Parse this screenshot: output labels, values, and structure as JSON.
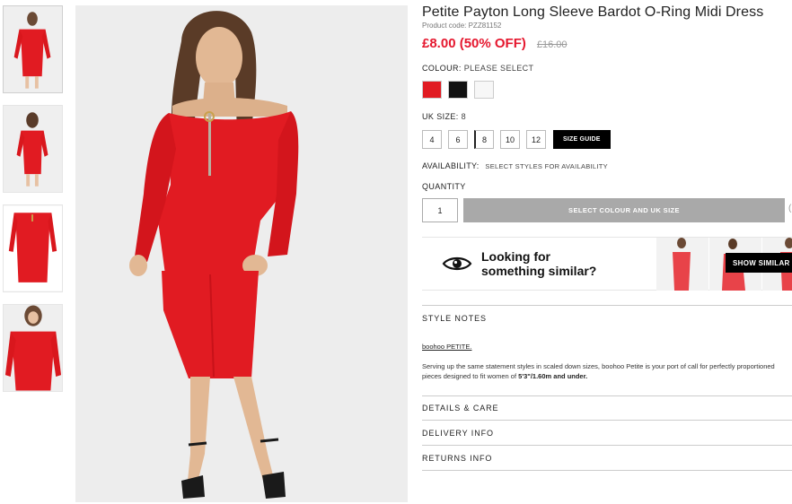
{
  "product": {
    "title": "Petite Payton Long Sleeve Bardot O-Ring Midi Dress",
    "code_label": "Product code: ",
    "code": "PZZ81152",
    "price": "£8.00 (50% OFF)",
    "old_price": "£16.00"
  },
  "colour": {
    "label": "COLOUR:",
    "value": "PLEASE SELECT",
    "swatches": [
      "#e11b22",
      "#111111",
      "#f7f7f7"
    ]
  },
  "size": {
    "label": "UK SIZE:",
    "value": "8",
    "options": [
      "4",
      "6",
      "8",
      "10",
      "12"
    ],
    "guide_label": "SIZE GUIDE"
  },
  "availability": {
    "label": "AVAILABILITY:",
    "note": "SELECT STYLES FOR AVAILABILITY"
  },
  "quantity": {
    "label": "QUANTITY",
    "value": "1",
    "button_label": "SELECT COLOUR AND UK SIZE"
  },
  "similar": {
    "line1": "Looking for",
    "line2": "something similar?",
    "button_label": "SHOW SIMILAR"
  },
  "style_notes": {
    "title": "STYLE NOTES",
    "brand_link": "boohoo PETITE.",
    "desc_start": "Serving up the same statement styles in scaled down sizes, boohoo Petite is your port of call for perfectly proportioned pieces designed to fit women of ",
    "desc_bold": "5'3\"/1.60m and under."
  },
  "sections": {
    "details": "DETAILS & CARE",
    "delivery": "DELIVERY INFO",
    "returns": "RETURNS INFO"
  },
  "colors": {
    "accent_red": "#e5172e",
    "dress_red": "#e11b22",
    "disabled_button": "#a9a9a9"
  }
}
